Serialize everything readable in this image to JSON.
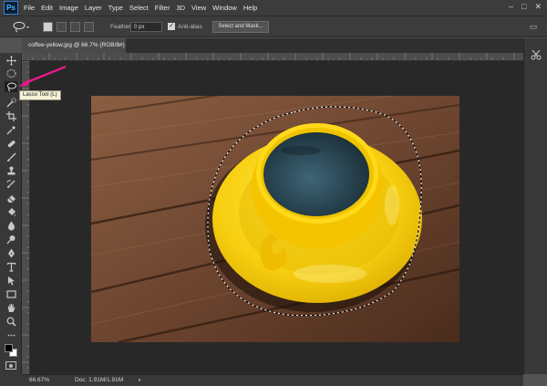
{
  "app": {
    "logo": "Ps"
  },
  "menu": [
    "File",
    "Edit",
    "Image",
    "Layer",
    "Type",
    "Select",
    "Filter",
    "3D",
    "View",
    "Window",
    "Help"
  ],
  "window_controls": {
    "minimize": "–",
    "maximize": "□",
    "close": "✕"
  },
  "options_bar": {
    "feather_label": "Feather:",
    "feather_value": "0 px",
    "antialias_label": "Anti-alias",
    "select_mask_label": "Select and Mask..."
  },
  "document_tab": {
    "title": "coffee-yellow.jpg @ 66.7% (RGB/8#)",
    "close": "×"
  },
  "tooltip": {
    "text": "Lasso Tool (L)"
  },
  "status_bar": {
    "zoom": "66.67%",
    "doc_size": "Doc: 1.91M/1.91M",
    "arrow": "▸"
  },
  "toolbar_tools": [
    "move-tool",
    "marquee-tool",
    "lasso-tool",
    "quick-selection-tool",
    "crop-tool",
    "eyedropper-tool",
    "healing-brush-tool",
    "brush-tool",
    "clone-stamp-tool",
    "history-brush-tool",
    "eraser-tool",
    "paint-bucket-tool",
    "blur-tool",
    "dodge-tool",
    "pen-tool",
    "type-tool",
    "path-selection-tool",
    "rectangle-tool",
    "hand-tool",
    "zoom-tool"
  ],
  "colors": {
    "foreground": "#000000",
    "background": "#ffffff",
    "annotation_arrow": "#e8188c",
    "ui_dark": "#383838"
  }
}
